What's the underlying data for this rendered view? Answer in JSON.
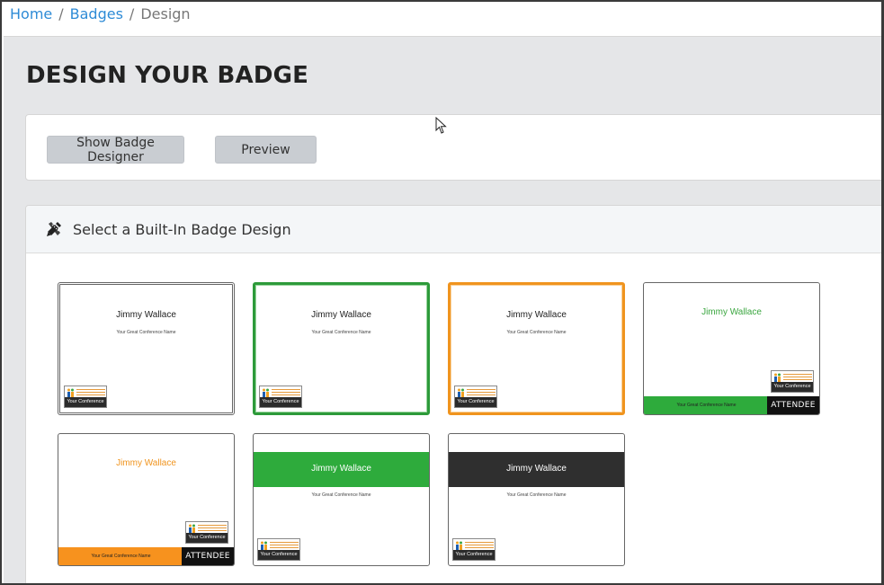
{
  "breadcrumb": {
    "home": "Home",
    "badges": "Badges",
    "current": "Design",
    "separator": "/"
  },
  "page": {
    "title": "DESIGN YOUR BADGE"
  },
  "toolbar": {
    "show_designer_label": "Show Badge Designer",
    "preview_label": "Preview"
  },
  "select_section": {
    "title": "Select a Built-In Badge Design",
    "icon": "pencil-ruler-icon"
  },
  "badges": [
    {
      "name": "Jimmy Wallace",
      "conference": "Your Great Conference Name",
      "logo_text": "Your Conference"
    },
    {
      "name": "Jimmy Wallace",
      "conference": "Your Great Conference Name",
      "logo_text": "Your Conference"
    },
    {
      "name": "Jimmy Wallace",
      "conference": "Your Great Conference Name",
      "logo_text": "Your Conference"
    },
    {
      "name": "Jimmy Wallace",
      "conference": "Your Great Conference Name",
      "logo_text": "Your Conference",
      "footer_label": "ATTENDEE"
    },
    {
      "name": "Jimmy Wallace",
      "conference": "Your Great Conference Name",
      "logo_text": "Your Conference",
      "footer_label": "ATTENDEE"
    },
    {
      "name": "Jimmy Wallace",
      "conference": "Your Great Conference Name",
      "logo_text": "Your Conference"
    },
    {
      "name": "Jimmy Wallace",
      "conference": "Your Great Conference Name",
      "logo_text": "Your Conference"
    }
  ],
  "colors": {
    "link": "#2e8bd6",
    "green": "#2d9a3a",
    "orange": "#f0941e",
    "dark_band": "#2f2f2f",
    "panel_bg": "#e5e6e8",
    "button_bg": "#c9cdd2"
  }
}
